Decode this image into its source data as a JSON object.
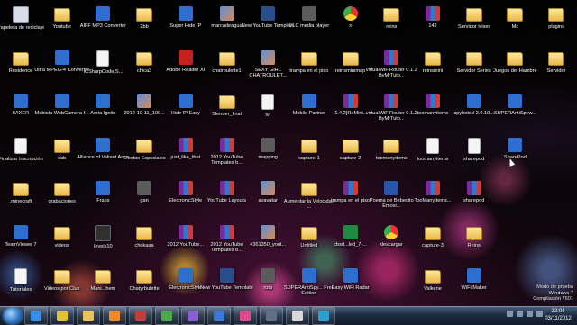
{
  "desktop": {
    "icons": [
      {
        "label": "Papelera de reciclaje",
        "type": "trash"
      },
      {
        "label": "Youtube",
        "type": "folder"
      },
      {
        "label": "AIFF MP3 Converter",
        "type": "exe"
      },
      {
        "label": "2bb",
        "type": "folder"
      },
      {
        "label": "Super Hide IP",
        "type": "exe"
      },
      {
        "label": "marcadeagua",
        "type": "img"
      },
      {
        "label": "New YouTube Template",
        "type": "video"
      },
      {
        "label": "VLC media player",
        "type": "misc"
      },
      {
        "label": "x",
        "type": "chrome"
      },
      {
        "label": "reins",
        "type": "folder"
      },
      {
        "label": "142",
        "type": "zip"
      },
      {
        "label": "Servidor ivixer",
        "type": "folder"
      },
      {
        "label": "Mc",
        "type": "folder"
      },
      {
        "label": "plugins",
        "type": "folder"
      },
      {
        "label": "Residence",
        "type": "folder"
      },
      {
        "label": "Ultra MPEG-4 Converter",
        "type": "exe"
      },
      {
        "label": "ICSharpCode.S...",
        "type": "doc"
      },
      {
        "label": "chica3",
        "type": "folder"
      },
      {
        "label": "Adobe Reader XI",
        "type": "pdf"
      },
      {
        "label": "chatroulette1",
        "type": "folder"
      },
      {
        "label": "SEXY GIRL CHATROULET...",
        "type": "img"
      },
      {
        "label": "trampa en el piso",
        "type": "folder"
      },
      {
        "label": "reinsminimap",
        "type": "folder"
      },
      {
        "label": "virtualWiFiRouter 0.1.2 ByMrTuto...",
        "type": "zip"
      },
      {
        "label": "reinsmini",
        "type": "folder"
      },
      {
        "label": "Servidor Series",
        "type": "folder"
      },
      {
        "label": "Juegos del Hambre",
        "type": "folder"
      },
      {
        "label": "Servidor",
        "type": "folder"
      },
      {
        "label": "IVIXER",
        "type": "exe"
      },
      {
        "label": "Mobiola WebCamera f...",
        "type": "exe"
      },
      {
        "label": "Aeria Ignite",
        "type": "exe"
      },
      {
        "label": "2012-10-11_100...",
        "type": "img"
      },
      {
        "label": "Hide IP Easy",
        "type": "exe"
      },
      {
        "label": "Slender_final",
        "type": "folder"
      },
      {
        "label": "ivi",
        "type": "doc"
      },
      {
        "label": "Mobile Partner",
        "type": "exe"
      },
      {
        "label": "[1.4.2]ReMini...",
        "type": "zip"
      },
      {
        "label": "virtualWiFiRouter 0.1.2 ByMrTuto...",
        "type": "zip"
      },
      {
        "label": "toomanyitems",
        "type": "zip"
      },
      {
        "label": "spybotsd-2.0.10...",
        "type": "exe"
      },
      {
        "label": "SUPERAntiSpyw...",
        "type": "exe"
      },
      {
        "label": "",
        "type": "none"
      },
      {
        "label": "Finalizar Inscripción",
        "type": "doc"
      },
      {
        "label": "cab",
        "type": "folder"
      },
      {
        "label": "Alliance of Valiant Arms",
        "type": "exe"
      },
      {
        "label": "Efectos Especiales",
        "type": "folder"
      },
      {
        "label": "just_like_that",
        "type": "zip"
      },
      {
        "label": "2012 YouTube Templates b...",
        "type": "zip"
      },
      {
        "label": "mapping",
        "type": "misc"
      },
      {
        "label": "capture-1",
        "type": "folder"
      },
      {
        "label": "capture-2",
        "type": "folder"
      },
      {
        "label": "toomanyitems",
        "type": "folder"
      },
      {
        "label": "toomanyitems",
        "type": "doc"
      },
      {
        "label": "sharepod",
        "type": "doc"
      },
      {
        "label": "SharePod",
        "type": "exe"
      },
      {
        "label": "",
        "type": "none"
      },
      {
        "label": ".minecraft",
        "type": "folder"
      },
      {
        "label": "grabaciones",
        "type": "folder"
      },
      {
        "label": "Fraps",
        "type": "exe"
      },
      {
        "label": "gan",
        "type": "misc"
      },
      {
        "label": "ElectronicStyle",
        "type": "zip"
      },
      {
        "label": "YouTube Layouts",
        "type": "zip"
      },
      {
        "label": "avavatar",
        "type": "img"
      },
      {
        "label": "Aumentar la Velocidad ...",
        "type": "folder"
      },
      {
        "label": "trampa en el piso",
        "type": "zip"
      },
      {
        "label": "Poema de Bebecito Emoxi...",
        "type": "word"
      },
      {
        "label": "TooManyItems...",
        "type": "zip"
      },
      {
        "label": "sharepod",
        "type": "zip"
      },
      {
        "label": "",
        "type": "none"
      },
      {
        "label": "",
        "type": "none"
      },
      {
        "label": "TeamViewer 7",
        "type": "exe"
      },
      {
        "label": "videos",
        "type": "folder"
      },
      {
        "label": "levels10",
        "type": "music"
      },
      {
        "label": "chokaaa",
        "type": "folder"
      },
      {
        "label": "2012 YouTube...",
        "type": "zip"
      },
      {
        "label": "2012 YouTube Templates b...",
        "type": "zip"
      },
      {
        "label": "4361350_yout...",
        "type": "img"
      },
      {
        "label": "Untitled",
        "type": "folder"
      },
      {
        "label": "cbsd...led_7-...",
        "type": "excel"
      },
      {
        "label": "descargar",
        "type": "chrome"
      },
      {
        "label": "capture-3",
        "type": "folder"
      },
      {
        "label": "Reins",
        "type": "folder"
      },
      {
        "label": "",
        "type": "none"
      },
      {
        "label": "",
        "type": "none"
      },
      {
        "label": "Tutoriales",
        "type": "doc"
      },
      {
        "label": "Videos por Clux",
        "type": "folder"
      },
      {
        "label": "Mani...hem",
        "type": "folder"
      },
      {
        "label": "Chatyrbulette",
        "type": "folder"
      },
      {
        "label": "ElectronicStyle",
        "type": "exe"
      },
      {
        "label": "New YouTube Template",
        "type": "video"
      },
      {
        "label": "ruta",
        "type": "misc"
      },
      {
        "label": "SUPERAntiSpy... Free Edition",
        "type": "exe"
      },
      {
        "label": "Easy WiFi Radar",
        "type": "exe"
      },
      {
        "label": "",
        "type": "none"
      },
      {
        "label": "Valkerie",
        "type": "folder"
      },
      {
        "label": "WiFi Maker",
        "type": "exe"
      },
      {
        "label": "",
        "type": "none"
      },
      {
        "label": "",
        "type": "none"
      }
    ]
  },
  "watermark": {
    "line1": "Modo de prueba",
    "line2": "Windows 7",
    "line3": "Compilación 7601"
  },
  "taskbar": {
    "items": [
      {
        "name": "ie-icon",
        "color": "#3b8ee8"
      },
      {
        "name": "chrome-icon",
        "color": "#e2c231"
      },
      {
        "name": "explorer-icon",
        "color": "#e9c25a"
      },
      {
        "name": "media-player-icon",
        "color": "#f08a2a"
      },
      {
        "name": "app-icon-1",
        "color": "#c33c3c"
      },
      {
        "name": "app-icon-2",
        "color": "#4caa4c"
      },
      {
        "name": "app-icon-3",
        "color": "#8b5fcf"
      },
      {
        "name": "app-icon-4",
        "color": "#3a79d8"
      },
      {
        "name": "app-icon-5",
        "color": "#e04a8f"
      },
      {
        "name": "app-icon-6",
        "color": "#5f6f86"
      },
      {
        "name": "app-icon-7",
        "color": "#d8d8d8"
      },
      {
        "name": "app-icon-8",
        "color": "#2f9fd0"
      }
    ],
    "clock_time": "22:04",
    "clock_date": "03/11/2012"
  }
}
